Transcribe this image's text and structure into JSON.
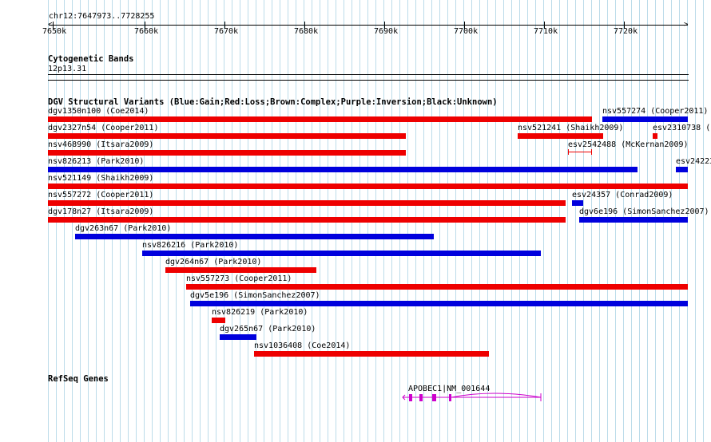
{
  "ruler": {
    "locus": "chr12:7647973..7728255",
    "tick_labels": [
      "7650k",
      "7660k",
      "7670k",
      "7680k",
      "7690k",
      "7700k",
      "7710k",
      "7720k"
    ]
  },
  "cytoband": {
    "title": "Cytogenetic Bands",
    "band": "12p13.31"
  },
  "dgv": {
    "title": "DGV Structural Variants (Blue:Gain;Red:Loss;Brown:Complex;Purple:Inversion;Black:Unknown)",
    "variants": [
      {
        "label": "dgv1350n100 (Coe2014)",
        "type": "loss"
      },
      {
        "label": "nsv557274 (Cooper2011)",
        "type": "gain"
      },
      {
        "label": "dgv2327n54 (Cooper2011)",
        "type": "loss"
      },
      {
        "label": "nsv521241 (Shaikh2009)",
        "type": "loss"
      },
      {
        "label": "esv2310738 (",
        "type": "loss"
      },
      {
        "label": "nsv468990 (Itsara2009)",
        "type": "loss"
      },
      {
        "label": "esv2542488 (McKernan2009)",
        "type": "loss"
      },
      {
        "label": "nsv826213 (Park2010)",
        "type": "gain"
      },
      {
        "label": "esv24223",
        "type": "gain"
      },
      {
        "label": "nsv521149 (Shaikh2009)",
        "type": "loss"
      },
      {
        "label": "nsv557272 (Cooper2011)",
        "type": "loss"
      },
      {
        "label": "esv24357 (Conrad2009)",
        "type": "gain"
      },
      {
        "label": "dgv178n27 (Itsara2009)",
        "type": "loss"
      },
      {
        "label": "dgv6e196 (SimonSanchez2007)",
        "type": "gain"
      },
      {
        "label": "dgv263n67 (Park2010)",
        "type": "gain"
      },
      {
        "label": "nsv826216 (Park2010)",
        "type": "gain"
      },
      {
        "label": "dgv264n67 (Park2010)",
        "type": "loss"
      },
      {
        "label": "nsv557273 (Cooper2011)",
        "type": "loss"
      },
      {
        "label": "dgv5e196 (SimonSanchez2007)",
        "type": "gain"
      },
      {
        "label": "nsv826219 (Park2010)",
        "type": "loss"
      },
      {
        "label": "dgv265n67 (Park2010)",
        "type": "gain"
      },
      {
        "label": "nsv1036408 (Coe2014)",
        "type": "loss"
      }
    ]
  },
  "refseq": {
    "title": "RefSeq Genes",
    "genes": [
      {
        "label": "APOBEC1|NM_001644"
      }
    ]
  },
  "colors": {
    "gain": "#0000dd",
    "loss": "#ee0000",
    "grid": "#bcdcea",
    "gene": "#cc00cc"
  }
}
